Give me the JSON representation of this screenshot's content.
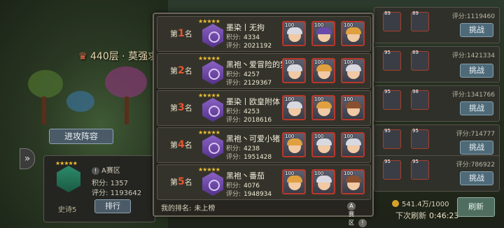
{
  "floor_text": "440层 · 莫强求、",
  "attack_lineup_label": "进攻阵容",
  "me": {
    "zone": "A赛区",
    "points_label": "积分:",
    "points": "1357",
    "score_label": "评分:",
    "score": "1193642",
    "rank_title": "史诗5",
    "rank_button": "排行"
  },
  "leaderboard": {
    "rank_prefix": "第",
    "rank_suffix": "名",
    "points_label": "积分:",
    "score_label": "评分:",
    "entries": [
      {
        "rank": "1",
        "name": "墨染丨无拘",
        "points": "4334",
        "score": "2021192",
        "levels": [
          "100",
          "100",
          "100"
        ],
        "hair": [
          "#d8d8e0",
          "#6a4aa8",
          "#e0a040"
        ]
      },
      {
        "rank": "2",
        "name": "黑袍丶爱冒险的梦",
        "points": "4257",
        "score": "2129367",
        "levels": [
          "100",
          "100",
          "100"
        ],
        "hair": [
          "#d8d8e0",
          "#e0a040",
          "#d8d8e0"
        ]
      },
      {
        "rank": "3",
        "name": "墨染丨欧皇附体",
        "points": "4253",
        "score": "2018616",
        "levels": [
          "100",
          "100",
          "100"
        ],
        "hair": [
          "#d8d8e0",
          "#e0a040",
          "#8a5030"
        ]
      },
      {
        "rank": "4",
        "name": "黑袍丶可爱小猪",
        "points": "4238",
        "score": "1951428",
        "levels": [
          "100",
          "100",
          "100"
        ],
        "hair": [
          "#e0a040",
          "#d8d8e0",
          "#d8d8e0"
        ]
      },
      {
        "rank": "5",
        "name": "黑袍丶番茄",
        "points": "4076",
        "score": "1948934",
        "levels": [
          "100",
          "100",
          "100"
        ],
        "hair": [
          "#e0a040",
          "#d8d8e0",
          "#8a5030"
        ]
      }
    ],
    "my_rank_label": "我的排名:",
    "my_rank_value": "未上榜",
    "zone": "A赛区",
    "info_icon": "!"
  },
  "right_list": {
    "rows": [
      {
        "levels": [
          "89",
          "89"
        ],
        "score": "评分:1119460",
        "button": "挑战"
      },
      {
        "levels": [
          "95",
          "89"
        ],
        "score": "评分:1421334",
        "button": "挑战"
      },
      {
        "levels": [
          "95",
          "98"
        ],
        "score": "评分:1341766",
        "button": "挑战"
      },
      {
        "levels": [
          "95",
          "95"
        ],
        "score": "评分:714777",
        "button": "挑战"
      },
      {
        "levels": [
          "95",
          "95"
        ],
        "score": "评分:786922",
        "button": "挑战"
      }
    ]
  },
  "currency": "541.4万/1000",
  "refresh_label": "下次刷新",
  "refresh_time": "0:46:23",
  "refresh_button": "刷新",
  "colors": {
    "accent_red": "#e8552e",
    "badge_purple": "#8a62c4",
    "gold": "#f0c030"
  }
}
